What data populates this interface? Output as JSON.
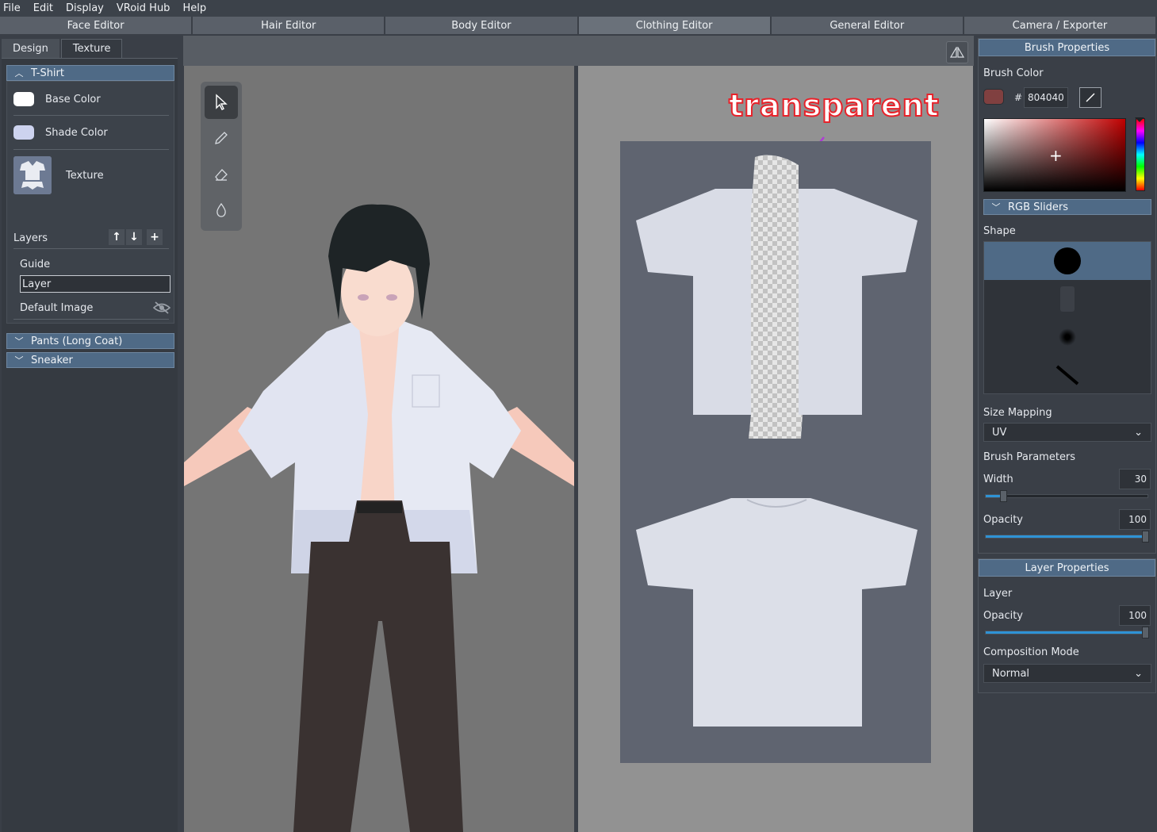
{
  "menu": [
    "File",
    "Edit",
    "Display",
    "VRoid Hub",
    "Help"
  ],
  "editor_tabs": [
    "Face Editor",
    "Hair Editor",
    "Body Editor",
    "Clothing Editor",
    "General Editor",
    "Camera / Exporter"
  ],
  "active_editor_tab": "Clothing Editor",
  "left": {
    "subtabs": [
      "Design",
      "Texture"
    ],
    "active_subtab": "Texture",
    "tshirt": {
      "header": "T-Shirt",
      "base_color_label": "Base Color",
      "base_color": "#ffffff",
      "shade_color_label": "Shade Color",
      "shade_color": "#cdd3ef",
      "texture_label": "Texture",
      "layers_label": "Layers",
      "layers": [
        "Guide",
        "Layer",
        "Default Image"
      ]
    },
    "pants_header": "Pants (Long Coat)",
    "sneaker_header": "Sneaker"
  },
  "viewport": {
    "annotation": "transparent"
  },
  "brush": {
    "title": "Brush Properties",
    "color_label": "Brush Color",
    "hex_prefix": "#",
    "hex": "804040",
    "color": "#804040",
    "rgb_sliders": "RGB Sliders",
    "shape_label": "Shape",
    "size_mapping_label": "Size Mapping",
    "size_mapping": "UV",
    "params_label": "Brush Parameters",
    "width_label": "Width",
    "width": "30",
    "width_max": 100,
    "opacity_label": "Opacity",
    "opacity": "100"
  },
  "layer_props": {
    "title": "Layer Properties",
    "layer_label": "Layer",
    "opacity_label": "Opacity",
    "opacity": "100",
    "composition_label": "Composition Mode",
    "composition": "Normal"
  }
}
